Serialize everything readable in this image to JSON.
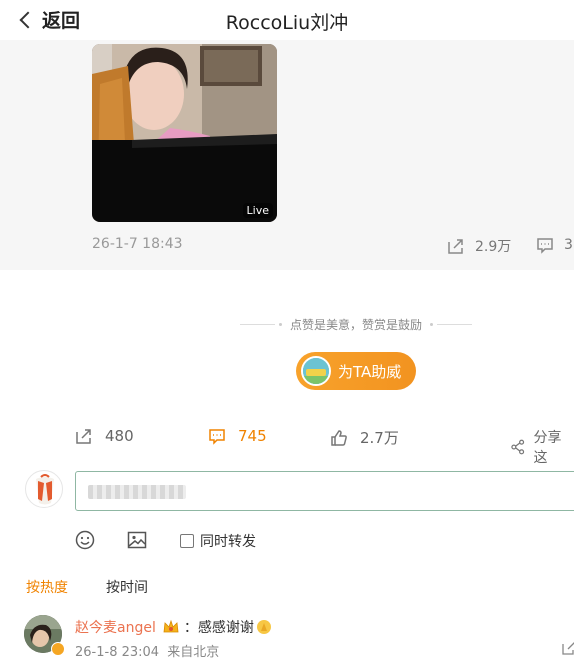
{
  "header": {
    "back_label": "返回",
    "title": "RoccoLiu刘冲"
  },
  "repost": {
    "live_badge": "Live",
    "time": "26-1-7 18:43",
    "repost_count": "2.9万",
    "comment_count": "3"
  },
  "reward": {
    "slogan": "点赞是美意，赞赏是鼓励",
    "button_label": "为TA助威"
  },
  "actions": {
    "repost_count": "480",
    "comment_count": "745",
    "like_count": "2.7万",
    "share_label": "分享这"
  },
  "composer": {
    "repost_label": "同时转发"
  },
  "sort_tabs": {
    "hot": "按热度",
    "time": "按时间"
  },
  "comment": {
    "user": "赵今麦angel",
    "text": "：感感谢谢",
    "time": "26-1-8 23:04",
    "source": "来自北京"
  },
  "colors": {
    "accent": "#f08300",
    "username": "#eb7350",
    "reward_button": "#f29320"
  }
}
